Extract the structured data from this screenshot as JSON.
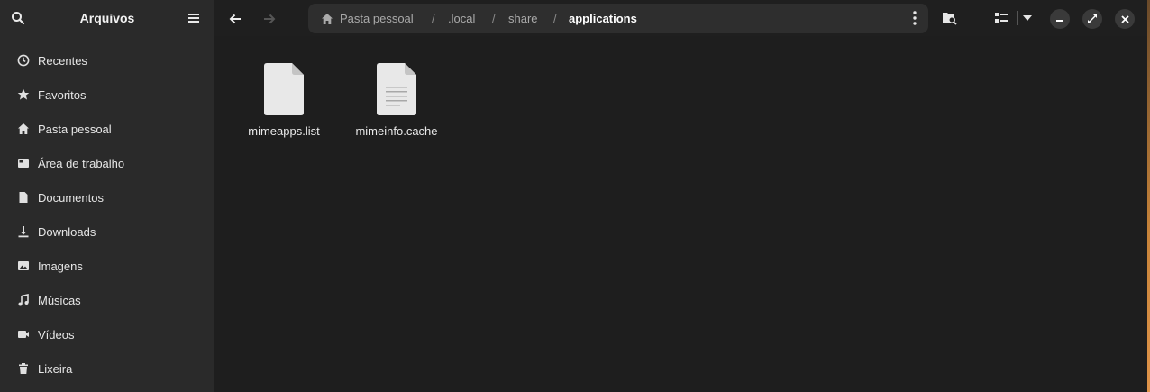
{
  "sidebar": {
    "title": "Arquivos",
    "items": [
      {
        "label": "Recentes",
        "icon": "clock-icon"
      },
      {
        "label": "Favoritos",
        "icon": "star-icon"
      },
      {
        "label": "Pasta pessoal",
        "icon": "home-icon"
      },
      {
        "label": "Área de trabalho",
        "icon": "desktop-icon"
      },
      {
        "label": "Documentos",
        "icon": "document-icon"
      },
      {
        "label": "Downloads",
        "icon": "download-icon"
      },
      {
        "label": "Imagens",
        "icon": "image-icon"
      },
      {
        "label": "Músicas",
        "icon": "music-icon"
      },
      {
        "label": "Vídeos",
        "icon": "video-icon"
      },
      {
        "label": "Lixeira",
        "icon": "trash-icon"
      }
    ]
  },
  "pathbar": {
    "crumbs": [
      "Pasta pessoal",
      ".local",
      "share",
      "applications"
    ],
    "separator": "/"
  },
  "files": [
    {
      "name": "mimeapps.list",
      "type": "blank"
    },
    {
      "name": "mimeinfo.cache",
      "type": "text"
    }
  ],
  "colors": {
    "background": "#1e1e1e",
    "sidebar": "#2a2a2a",
    "pathbar": "#2e2e2e"
  }
}
